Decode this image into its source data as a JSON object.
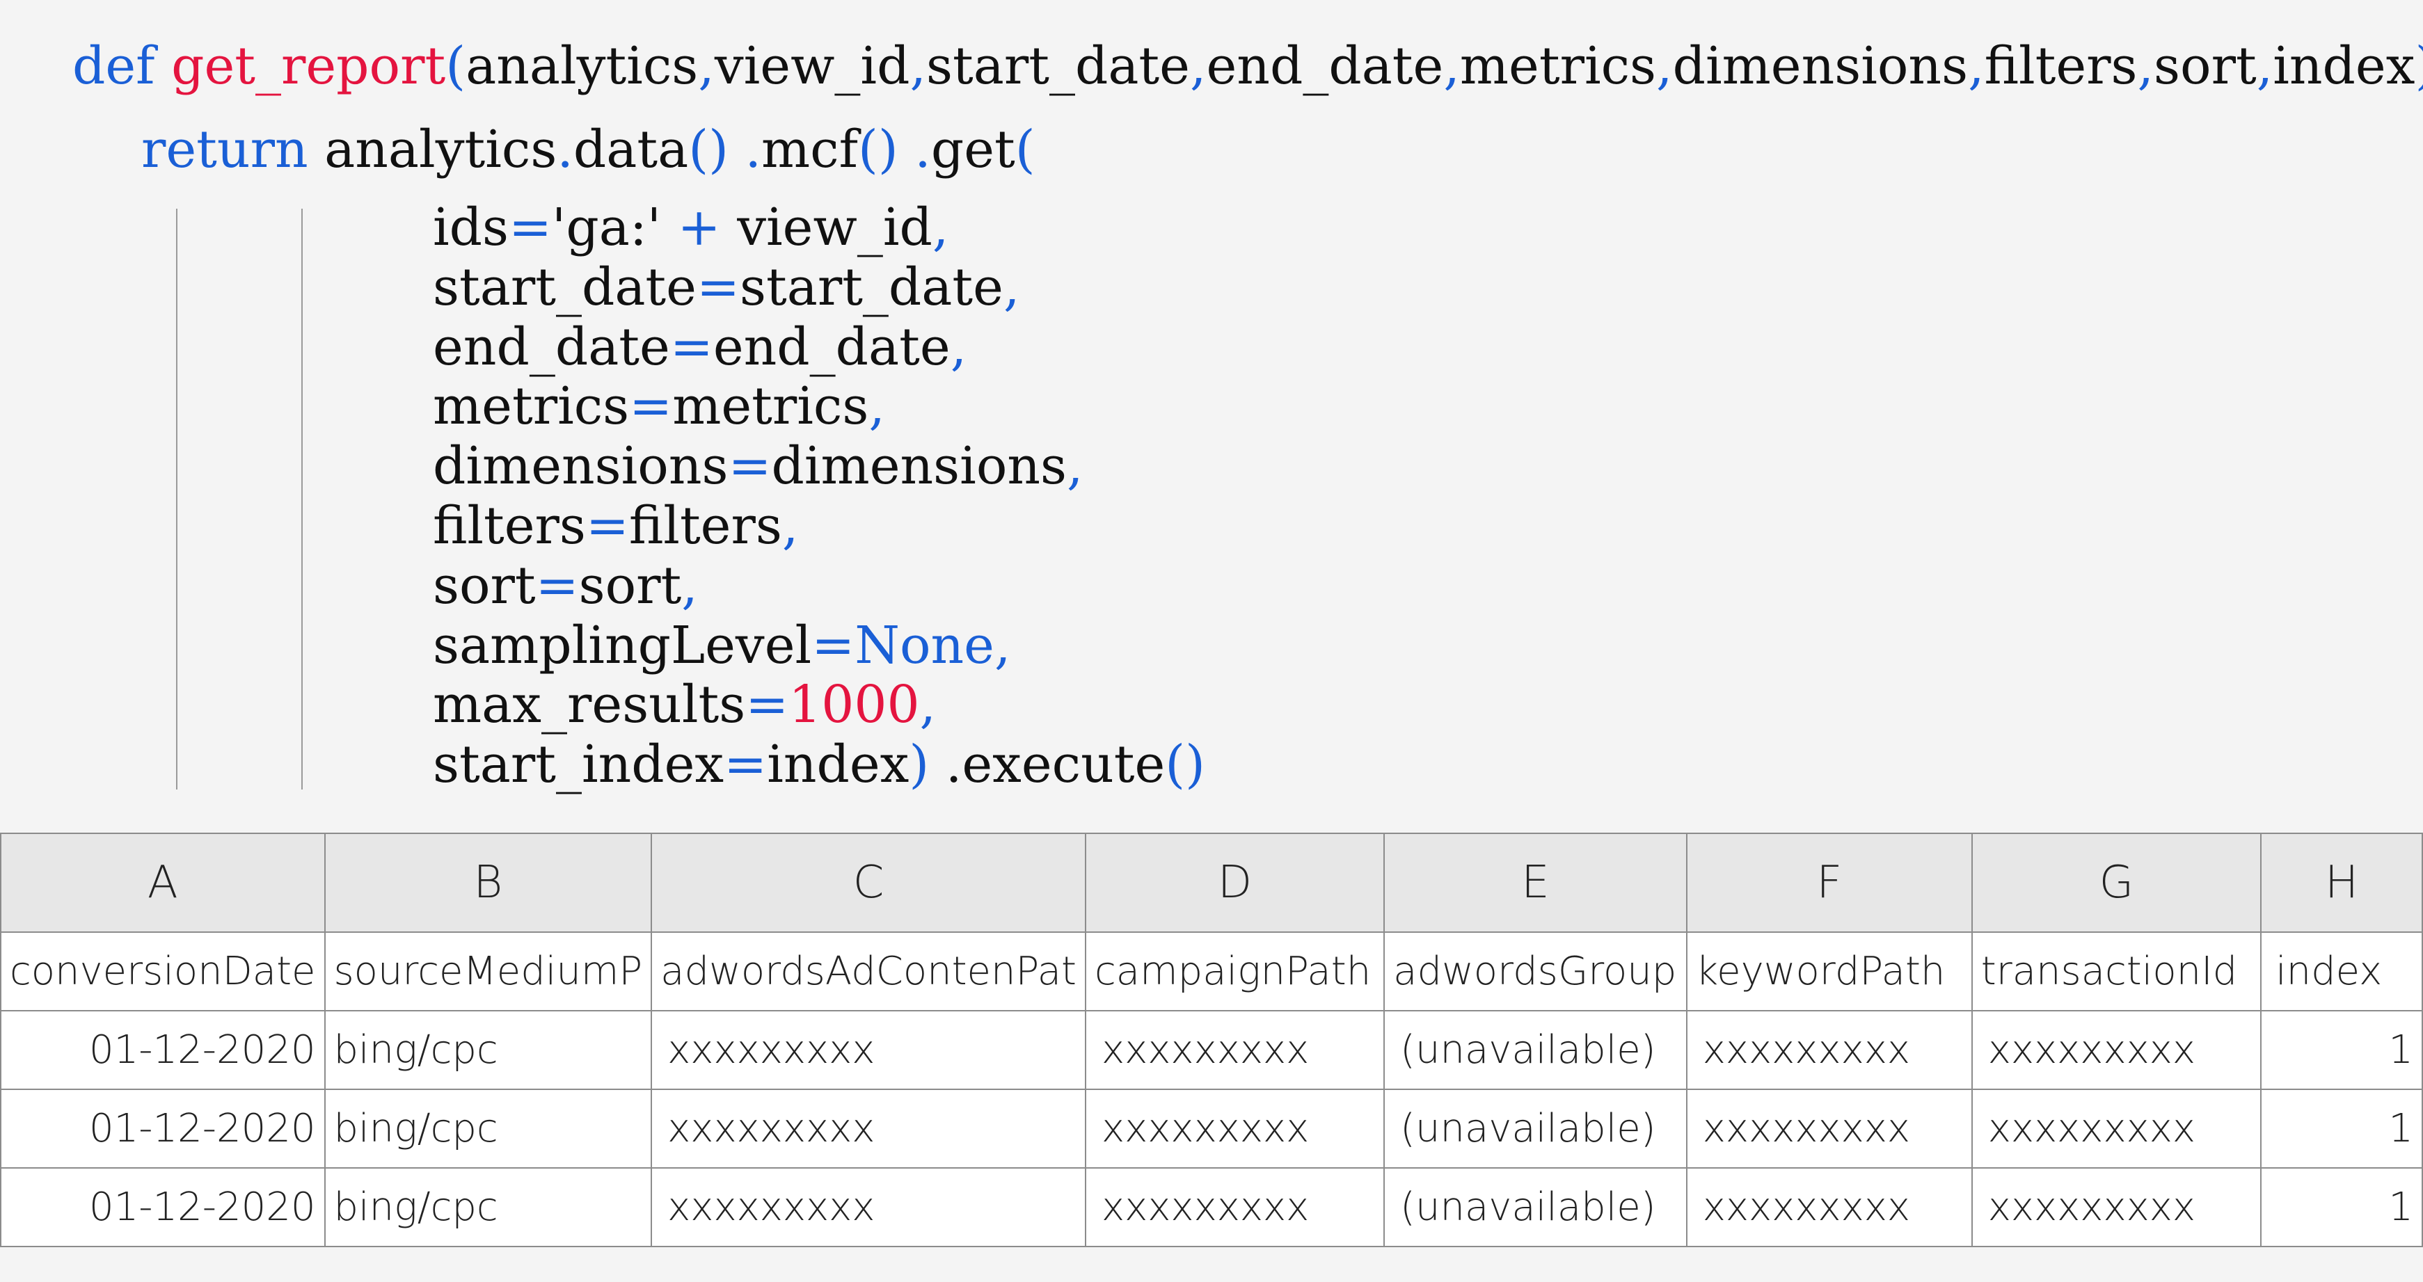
{
  "code": {
    "line1": {
      "kw": "def",
      "fn": "get_report",
      "open": "(",
      "params": [
        {
          "name": "analytics",
          "sep": ","
        },
        {
          "name": "view_id",
          "sep": ","
        },
        {
          "name": "start_date",
          "sep": ","
        },
        {
          "name": "end_date",
          "sep": ","
        },
        {
          "name": "metrics",
          "sep": ","
        },
        {
          "name": "dimensions",
          "sep": ","
        },
        {
          "name": "filters",
          "sep": ","
        },
        {
          "name": "sort",
          "sep": ","
        },
        {
          "name": "index",
          "sep": ""
        }
      ],
      "close": "):"
    },
    "line2": {
      "kw": "return",
      "obj": "analytics",
      "dot1": ".",
      "m1": "data",
      "p1": "()",
      "dot2": " .",
      "m2": "mcf",
      "p2": "()",
      "dot3": " .",
      "m3": "get",
      "p3": "("
    },
    "args": [
      {
        "key": "ids",
        "eq": "=",
        "val": "'ga:' ",
        "op": "+",
        "val2": " view_id",
        "tail": ","
      },
      {
        "key": "start_date",
        "eq": "=",
        "val": "start_date",
        "tail": ","
      },
      {
        "key": "end_date",
        "eq": "=",
        "val": "end_date",
        "tail": ","
      },
      {
        "key": "metrics",
        "eq": "=",
        "val": "metrics",
        "tail": ","
      },
      {
        "key": "dimensions",
        "eq": "=",
        "val": "dimensions",
        "tail": ","
      },
      {
        "key": "filters",
        "eq": "=",
        "val": "filters",
        "tail": ","
      },
      {
        "key": "sort",
        "eq": "=",
        "val": "sort",
        "tail": ","
      },
      {
        "key": "samplingLevel",
        "eq": "=",
        "valKw": "None",
        "tail": ","
      },
      {
        "key": "max_results",
        "eq": "=",
        "valNum": "1000",
        "tail": ","
      },
      {
        "key": "start_index",
        "eq": "=",
        "val": "index",
        "tail": ")",
        "rest": " .execute",
        "restParen": "()"
      }
    ]
  },
  "sheet": {
    "columns": [
      "A",
      "B",
      "C",
      "D",
      "E",
      "F",
      "G",
      "H"
    ],
    "headers": [
      "conversionDate",
      "sourceMediumP",
      "adwordsAdContenPat",
      " campaignPath",
      "adwordsGroup",
      "keywordPath",
      "transactionId",
      "index"
    ],
    "rows": [
      [
        "01-12-2020",
        "bing/cpc",
        "xxxxxxxxx",
        "xxxxxxxxx",
        "(unavailable)",
        "xxxxxxxxx",
        "xxxxxxxxx",
        "1"
      ],
      [
        "01-12-2020",
        "bing/cpc",
        "xxxxxxxxx",
        "xxxxxxxxx",
        "(unavailable)",
        "xxxxxxxxx",
        "xxxxxxxxx",
        "1"
      ],
      [
        "01-12-2020",
        "bing/cpc",
        "xxxxxxxxx",
        "xxxxxxxxx",
        "(unavailable)",
        "xxxxxxxxx",
        "xxxxxxxxx",
        "1"
      ]
    ]
  },
  "colors": {
    "keyword": "#1a5fd6",
    "function": "#e4143f",
    "number": "#e4143f"
  }
}
